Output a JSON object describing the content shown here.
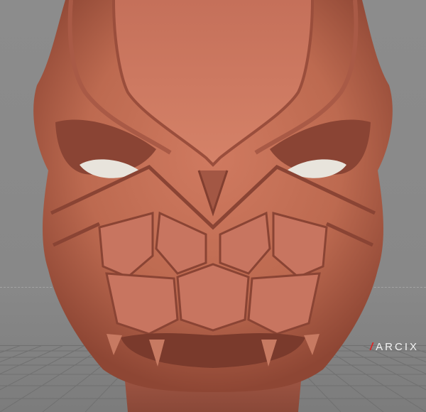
{
  "viewport": {
    "background_color": "#8a8a8a",
    "grid_color": "#6f6f6f",
    "horizon_color": "#a3a3a3"
  },
  "model": {
    "material_color": "#c06a52",
    "eye_color": "#e8e4dc",
    "subject": "sculpted-creature-head-icon"
  },
  "watermark": {
    "slash": "/",
    "text": "ARCIX",
    "slash_color": "#e02020",
    "text_color": "#f2f2f2"
  }
}
